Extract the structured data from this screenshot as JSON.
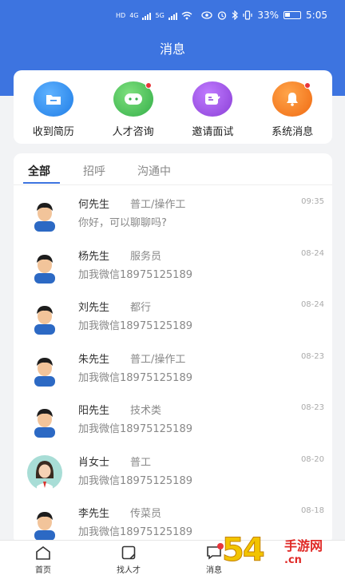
{
  "status_bar": {
    "net_a": "HD",
    "net_b": "4G",
    "net_c": "5G",
    "battery": "33%",
    "time": "5:05"
  },
  "header": {
    "title": "消息"
  },
  "quick_actions": [
    {
      "label": "收到简历",
      "icon": "folder-icon",
      "color": "#2d8cf0",
      "badge": false
    },
    {
      "label": "人才咨询",
      "icon": "chat-face-icon",
      "color": "#4cc35a",
      "badge": true
    },
    {
      "label": "邀请面试",
      "icon": "invite-edit-icon",
      "color": "#9a4ee0",
      "badge": false
    },
    {
      "label": "系统消息",
      "icon": "bell-icon",
      "color": "#ff7a1a",
      "badge": true
    }
  ],
  "tabs": [
    {
      "label": "全部",
      "active": true
    },
    {
      "label": "招呼",
      "active": false
    },
    {
      "label": "沟通中",
      "active": false
    }
  ],
  "messages": [
    {
      "name": "何先生",
      "job": "普工/操作工",
      "time": "09:35",
      "text": "你好，可以聊聊吗?",
      "avatar": "male-avatar"
    },
    {
      "name": "杨先生",
      "job": "服务员",
      "time": "08-24",
      "text": "加我微信18975125189",
      "avatar": "male-avatar"
    },
    {
      "name": "刘先生",
      "job": "都行",
      "time": "08-24",
      "text": "加我微信18975125189",
      "avatar": "male-avatar"
    },
    {
      "name": "朱先生",
      "job": "普工/操作工",
      "time": "08-23",
      "text": "加我微信18975125189",
      "avatar": "male-avatar"
    },
    {
      "name": "阳先生",
      "job": "技术类",
      "time": "08-23",
      "text": "加我微信18975125189",
      "avatar": "male-avatar"
    },
    {
      "name": "肖女士",
      "job": "普工",
      "time": "08-20",
      "text": "加我微信18975125189",
      "avatar": "female-avatar"
    },
    {
      "name": "李先生",
      "job": "传菜员",
      "time": "08-18",
      "text": "加我微信18975125189",
      "avatar": "male-avatar"
    }
  ],
  "bottom_nav": [
    {
      "label": "首页",
      "icon": "home-icon"
    },
    {
      "label": "找人才",
      "icon": "find-talent-icon"
    },
    {
      "label": "消息",
      "icon": "message-icon"
    }
  ],
  "watermark": {
    "number": "54",
    "title": "手游网",
    "url": ".cn"
  },
  "colors": {
    "brand_blue": "#3d74e0",
    "badge_red": "#e8353a"
  }
}
